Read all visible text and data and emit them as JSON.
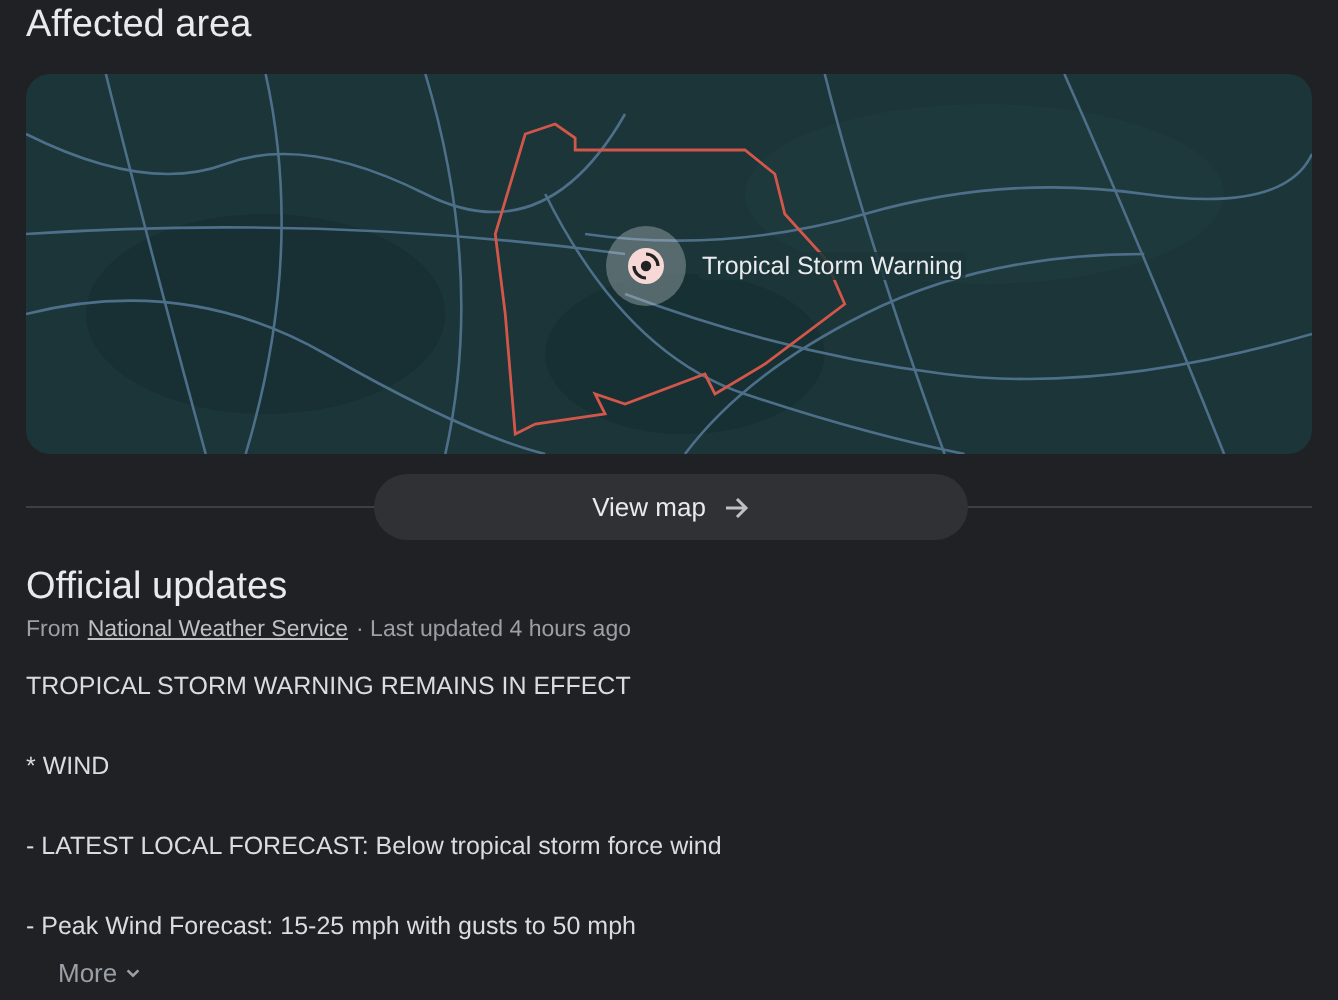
{
  "affected_area": {
    "title": "Affected area",
    "map": {
      "kind": "picture",
      "marker": {
        "label": "Tropical Storm Warning"
      }
    },
    "view_map_button": {
      "label": "View map"
    }
  },
  "official_updates": {
    "title": "Official updates",
    "source_prefix": "From",
    "source_link": "National Weather Service",
    "updated": "· Last updated 4 hours ago",
    "lines": [
      "TROPICAL STORM WARNING REMAINS IN EFFECT",
      "* WIND",
      "- LATEST LOCAL FORECAST: Below tropical storm force wind",
      "- Peak Wind Forecast: 15-25 mph with gusts to 50 mph"
    ],
    "more_button": {
      "label": "More",
      "expanded": false
    }
  }
}
